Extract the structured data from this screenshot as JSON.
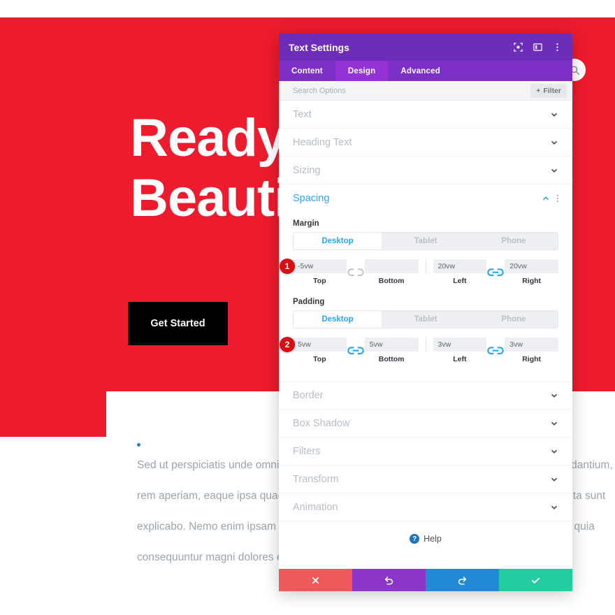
{
  "background": {
    "hero_title_line1": "Ready to",
    "hero_title_line2": "Beautiful",
    "cta_label": "Get Started",
    "search_icon": "search-icon",
    "bullet_icon": "bullet-dot",
    "body_lines": [
      "Sed ut perspiciatis unde omnis iste natus error sit voluptatem accusantium doloremque laudantium, totam",
      "rem aperiam, eaque ipsa quae ab illo inventore veritatis et quasi architecto beatae vitae dicta sunt",
      "explicabo. Nemo enim ipsam voluptatem quia voluptas sit aspernatur aut odit aut fugit, sed quia",
      "consequuntur magni dolores eos qui ratione voluptatem sequi nesciunt."
    ],
    "hero_bg_color": "#ED1B2E"
  },
  "modal": {
    "title": "Text Settings",
    "header_icons": [
      {
        "name": "focus-icon"
      },
      {
        "name": "layout-panel-icon"
      },
      {
        "name": "more-vertical-icon"
      }
    ],
    "tabs": [
      {
        "label": "Content",
        "active": false
      },
      {
        "label": "Design",
        "active": true
      },
      {
        "label": "Advanced",
        "active": false
      }
    ],
    "search": {
      "placeholder": "Search Options"
    },
    "filter_button": {
      "label": "Filter",
      "icon": "plus-icon"
    },
    "sections": [
      {
        "label": "Text",
        "open": false
      },
      {
        "label": "Heading Text",
        "open": false
      },
      {
        "label": "Sizing",
        "open": false
      },
      {
        "label": "Spacing",
        "open": true
      }
    ],
    "sections_bottom": [
      {
        "label": "Border",
        "open": false
      },
      {
        "label": "Box Shadow",
        "open": false
      },
      {
        "label": "Filters",
        "open": false
      },
      {
        "label": "Transform",
        "open": false
      },
      {
        "label": "Animation",
        "open": false
      }
    ],
    "spacing": {
      "margin": {
        "group_label": "Margin",
        "badge": "1",
        "devices": [
          {
            "label": "Desktop",
            "active": true
          },
          {
            "label": "Tablet",
            "active": false
          },
          {
            "label": "Phone",
            "active": false
          }
        ],
        "top": {
          "value": "-5vw",
          "label": "Top"
        },
        "bottom": {
          "value": "",
          "label": "Bottom"
        },
        "left": {
          "value": "20vw",
          "label": "Left"
        },
        "right": {
          "value": "20vw",
          "label": "Right"
        },
        "link_tb": {
          "icon": "link-broken-icon",
          "linked": false
        },
        "link_lr": {
          "icon": "link-icon",
          "linked": true
        }
      },
      "padding": {
        "group_label": "Padding",
        "badge": "2",
        "devices": [
          {
            "label": "Desktop",
            "active": true
          },
          {
            "label": "Tablet",
            "active": false
          },
          {
            "label": "Phone",
            "active": false
          }
        ],
        "top": {
          "value": "5vw",
          "label": "Top"
        },
        "bottom": {
          "value": "5vw",
          "label": "Bottom"
        },
        "left": {
          "value": "3vw",
          "label": "Left"
        },
        "right": {
          "value": "3vw",
          "label": "Right"
        },
        "link_tb": {
          "icon": "link-icon",
          "linked": true
        },
        "link_lr": {
          "icon": "link-icon",
          "linked": true
        }
      }
    },
    "help": {
      "label": "Help",
      "icon": "question-icon",
      "mark": "?"
    },
    "actions": [
      {
        "name": "cancel-button",
        "icon": "close-icon",
        "color": "#F05A5A"
      },
      {
        "name": "undo-button",
        "icon": "undo-icon",
        "color": "#8B36C9"
      },
      {
        "name": "redo-button",
        "icon": "redo-icon",
        "color": "#2189D6"
      },
      {
        "name": "save-button",
        "icon": "check-icon",
        "color": "#24CCA0"
      }
    ]
  }
}
